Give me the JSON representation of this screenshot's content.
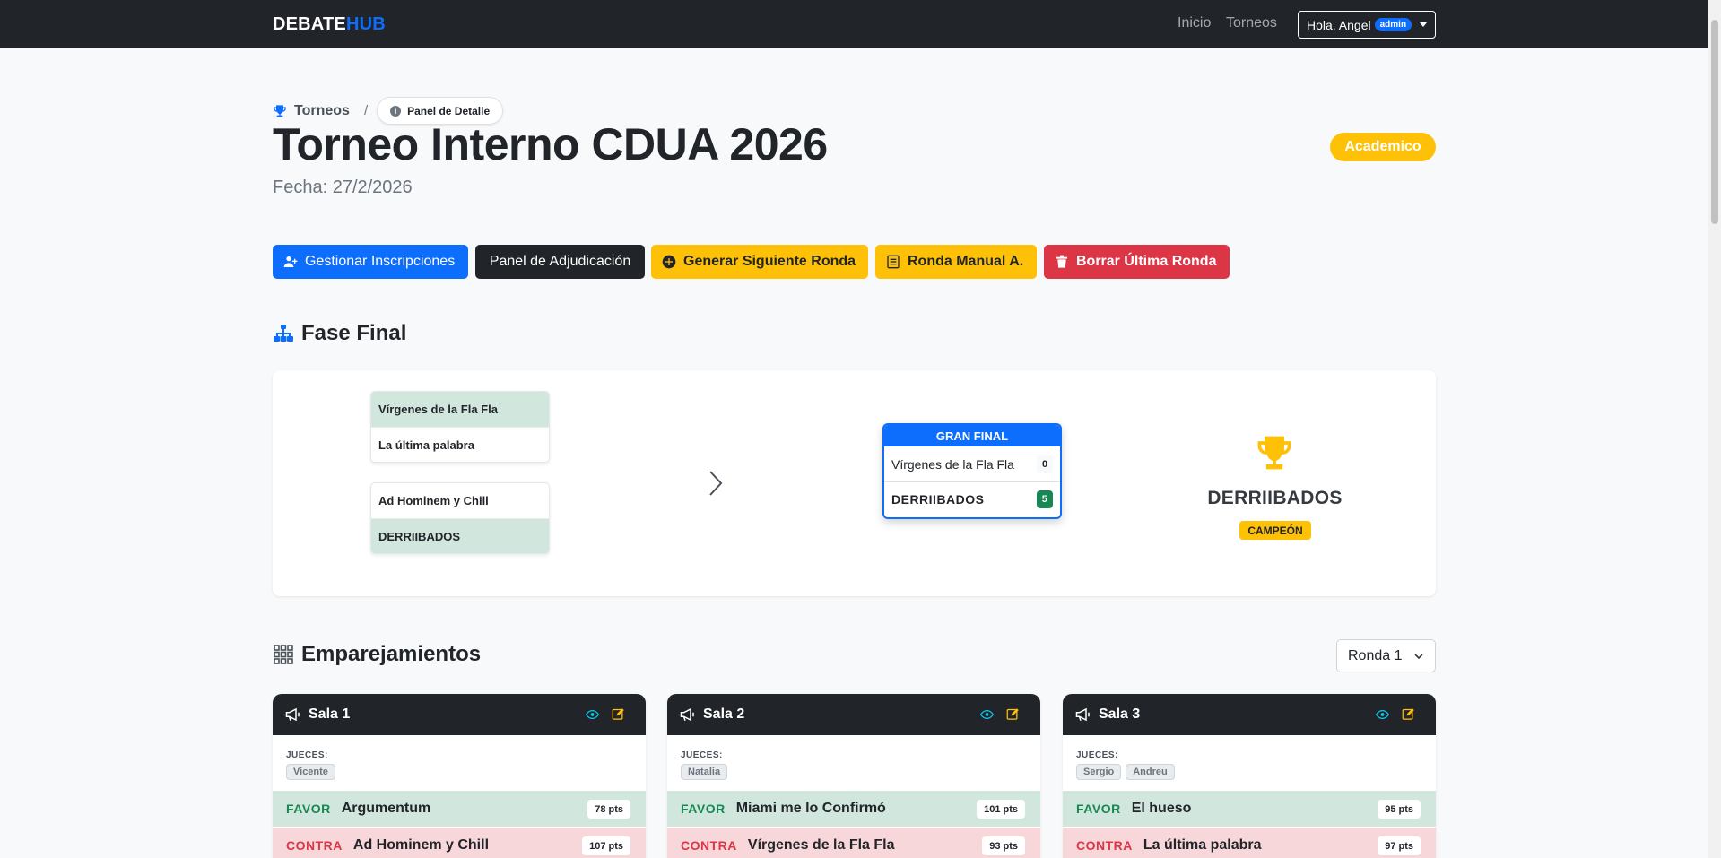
{
  "nav": {
    "brand_part1": "DEBATE",
    "brand_part2": "HUB",
    "links": [
      "Inicio",
      "Torneos"
    ],
    "user_greeting": "Hola, Angel",
    "user_role": "admin"
  },
  "breadcrumb": {
    "root": "Torneos",
    "separator": "/",
    "current": "Panel de Detalle"
  },
  "tournament": {
    "title": "Torneo Interno CDUA 2026",
    "date": "Fecha: 27/2/2026",
    "type": "Academico"
  },
  "actions": {
    "manage_registrations": "Gestionar Inscripciones",
    "adjudication_panel": "Panel de Adjudicación",
    "generate_next_round": "Generar Siguiente Ronda",
    "manual_round": "Ronda Manual A.",
    "delete_last_round": "Borrar Última Ronda"
  },
  "final_phase": {
    "title": "Fase Final",
    "semifinals": [
      {
        "team_a": "Vírgenes de la Fla Fla",
        "team_b": "La última palabra",
        "winner": "a"
      },
      {
        "team_a": "Ad Hominem y Chill",
        "team_b": "DERRIIBADOS",
        "winner": "b"
      }
    ],
    "grand_final": {
      "label": "GRAN FINAL",
      "team_a": "Vírgenes de la Fla Fla",
      "score_a": "0",
      "team_b": "DERRIIBADOS",
      "score_b": "5"
    },
    "champion": {
      "name": "DERRIIBADOS",
      "badge": "CAMPEÓN"
    }
  },
  "pairings": {
    "title": "Emparejamientos",
    "round_select": "Ronda 1",
    "judges_label": "JUECES:",
    "favor_label": "FAVOR",
    "contra_label": "CONTRA",
    "rooms": [
      {
        "name": "Sala 1",
        "judges": [
          "Vicente"
        ],
        "favor_team": "Argumentum",
        "favor_pts": "78 pts",
        "contra_team": "Ad Hominem y Chill",
        "contra_pts": "107 pts"
      },
      {
        "name": "Sala 2",
        "judges": [
          "Natalia"
        ],
        "favor_team": "Miami me lo Confirmó",
        "favor_pts": "101 pts",
        "contra_team": "Vírgenes de la Fla Fla",
        "contra_pts": "93 pts"
      },
      {
        "name": "Sala 3",
        "judges": [
          "Sergio",
          "Andreu"
        ],
        "favor_team": "El hueso",
        "favor_pts": "95 pts",
        "contra_team": "La última palabra",
        "contra_pts": "97 pts"
      }
    ]
  },
  "colors": {
    "primary": "#0d6efd",
    "dark": "#212529",
    "warning": "#ffc107",
    "danger": "#dc3545",
    "success": "#198754",
    "favor_bg": "#d1e7dd",
    "contra_bg": "#f8d7da"
  },
  "icons": {
    "breadcrumb": "trophy-icon",
    "manage": "user-plus-icon",
    "generate": "plus-circle-icon",
    "manual": "list-icon",
    "delete": "trash-icon",
    "final_phase": "sitemap-icon",
    "pairings": "grid-icon",
    "room": "megaphone-icon",
    "view": "eye-icon",
    "edit": "edit-icon",
    "champion": "trophy-icon"
  }
}
